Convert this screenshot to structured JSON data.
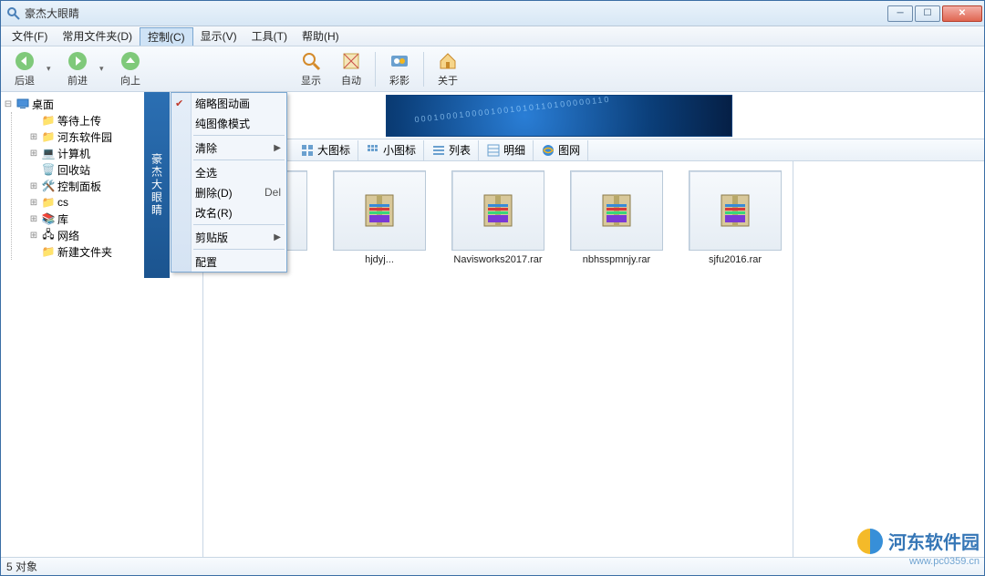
{
  "window": {
    "title": "豪杰大眼睛"
  },
  "menubar": {
    "items": [
      "文件(F)",
      "常用文件夹(D)",
      "控制(C)",
      "显示(V)",
      "工具(T)",
      "帮助(H)"
    ],
    "active_index": 2
  },
  "toolbar": {
    "back": "后退",
    "forward": "前进",
    "up": "向上",
    "show": "显示",
    "auto": "自动",
    "caiying": "彩影",
    "about": "关于"
  },
  "dropdown": {
    "thumb_anim": "缩略图动画",
    "pure_image": "纯图像模式",
    "clear": "清除",
    "select_all": "全选",
    "delete": "删除(D)",
    "delete_shortcut": "Del",
    "rename": "改名(R)",
    "clipboard": "剪贴版",
    "config": "配置"
  },
  "brand_vertical": "豪杰大眼睛",
  "tree": {
    "root": "桌面",
    "items": [
      {
        "label": "等待上传"
      },
      {
        "label": "河东软件园"
      },
      {
        "label": "计算机"
      },
      {
        "label": "回收站"
      },
      {
        "label": "控制面板"
      },
      {
        "label": "cs"
      },
      {
        "label": "库"
      },
      {
        "label": "网络"
      },
      {
        "label": "新建文件夹"
      }
    ]
  },
  "view_toolbar": {
    "big_icons": "大图标",
    "small_icons": "小图标",
    "list": "列表",
    "details": "明细",
    "web": "图网"
  },
  "files": [
    {
      "label": ".."
    },
    {
      "label": "hjdyj..."
    },
    {
      "label": "Navisworks2017.rar"
    },
    {
      "label": "nbhsspmnjy.rar"
    },
    {
      "label": "sjfu2016.rar"
    }
  ],
  "statusbar": {
    "text": "5 对象"
  },
  "watermark": {
    "name": "河东软件园",
    "url": "www.pc0359.cn"
  }
}
